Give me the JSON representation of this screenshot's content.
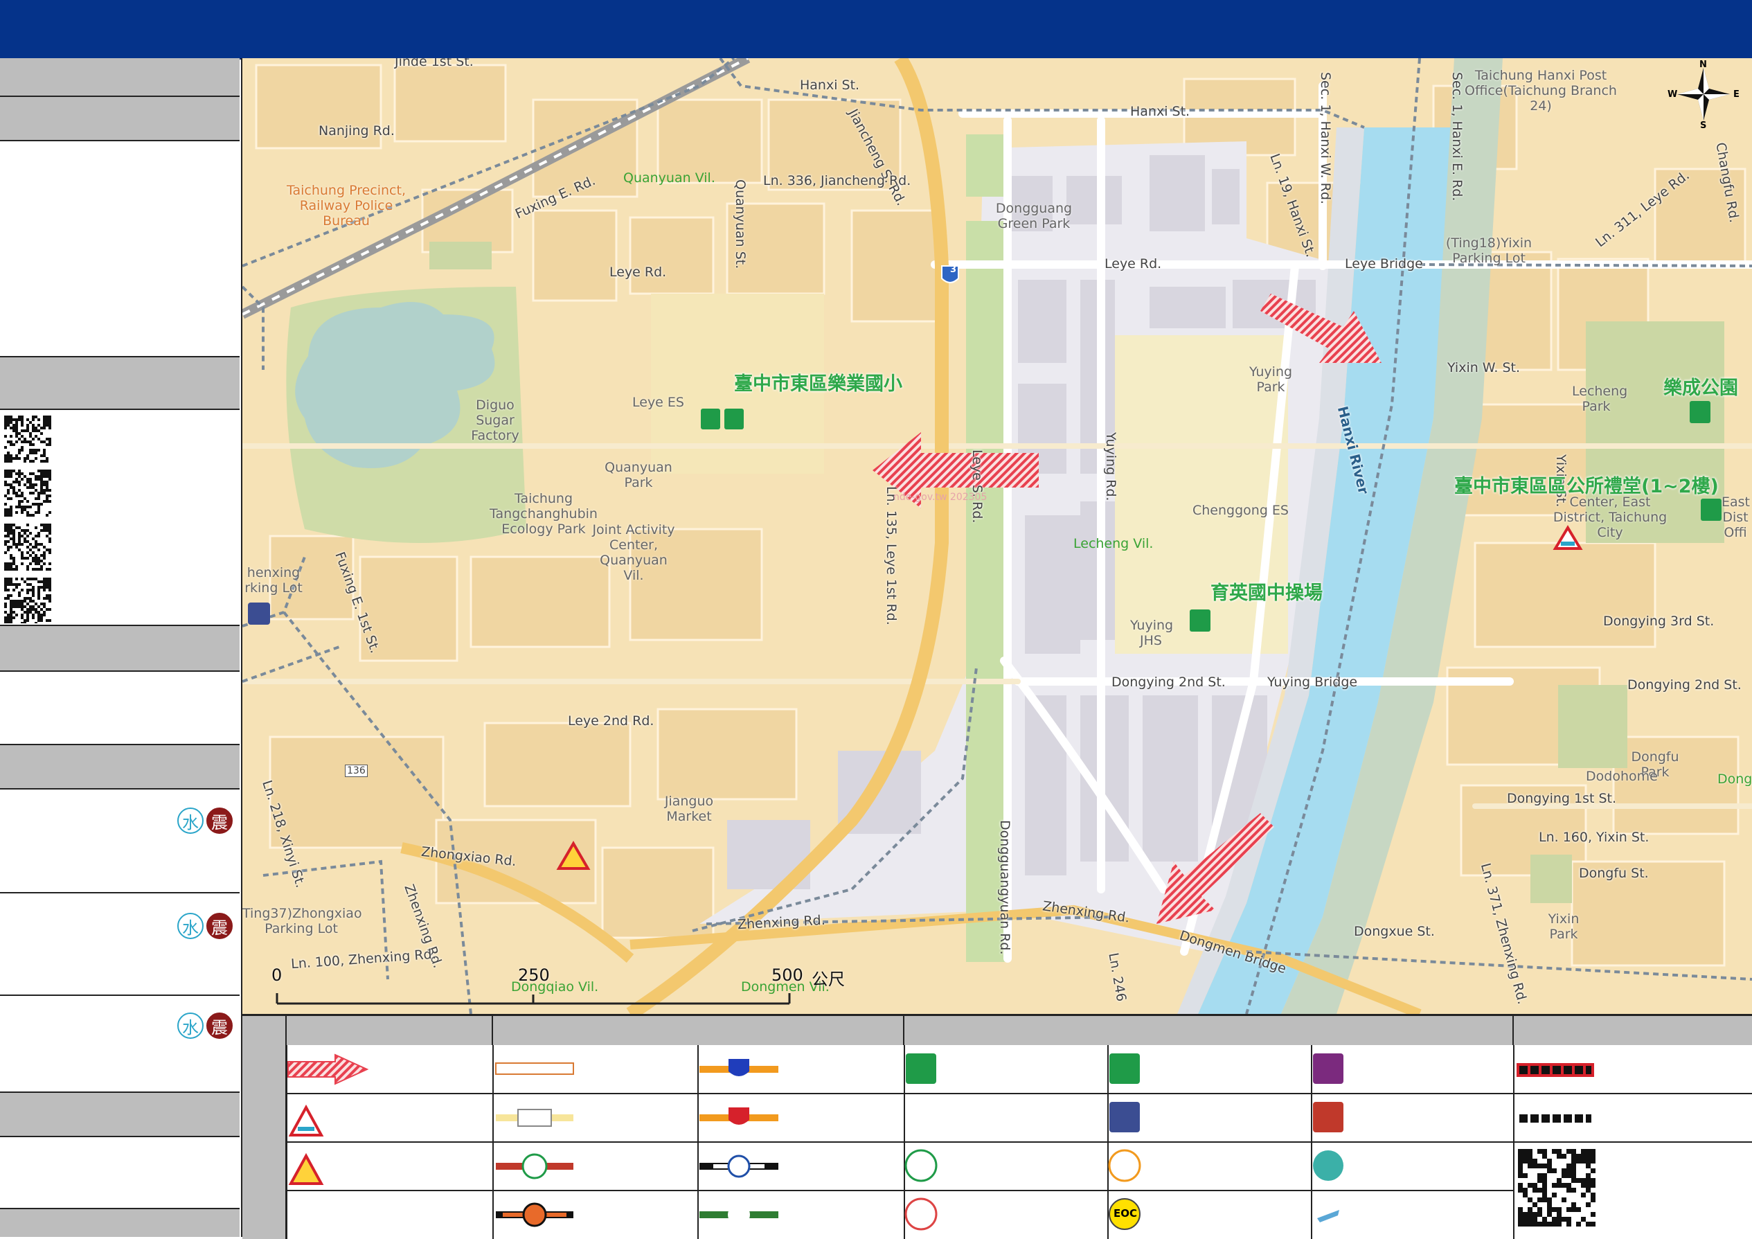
{
  "map": {
    "scale_bar": {
      "tick0": "0",
      "tick1": "250",
      "tick2": "500",
      "unit": "公尺"
    },
    "shelters": [
      {
        "name": "臺中市東區樂業國小"
      },
      {
        "name": "育英國中操場"
      },
      {
        "name": "樂成公園"
      },
      {
        "name": "臺中市東區區公所禮堂(1~2樓)"
      }
    ],
    "roads": [
      "Jinde 1st St.",
      "Nanjing Rd.",
      "Hanxi St.",
      "Hanxi St.",
      "Jiancheng S. Rd.",
      "Fuxing E. Rd.",
      "Ln. 336, Jiancheng Rd.",
      "Quanyuan St.",
      "Leye Rd.",
      "Leye Rd.",
      "Leye Bridge",
      "Ln. 19, Hanxi St.",
      "Sec. 1, Hanxi W. Rd.",
      "Sec. 1, Hanxi E. Rd.",
      "Yuying Rd.",
      "Ln. 135, Leye 1st Rd.",
      "Leye S. Rd.",
      "Fuxing E. 1st St.",
      "Leye 2nd Rd.",
      "Dongying 2nd St.",
      "Yuying Bridge",
      "Dongying 3rd St.",
      "Dongying 2nd St.",
      "Dongying 1st St.",
      "Ln. 160, Yixin St.",
      "Dongfu St.",
      "Dongxue St.",
      "Ln. 371, Zhenxing Rd.",
      "Zhenxing Rd.",
      "Zhenxing Rd.",
      "Dongmen Bridge",
      "Dongguangyuan Rd.",
      "Zhongxiao Rd.",
      "Zhenxing Rd.",
      "Ln. 100, Zhenxing Rd.",
      "Ln. 218, Xinyi St.",
      "Ln. 246",
      "Yixin W. St.",
      "Ln. 311, Leye Rd.",
      "Changfu Rd.",
      "Yixin St.",
      "Hanxi River"
    ],
    "pois": [
      "Taichung Precinct, Railway Police Bureau",
      "Diguo Sugar Factory",
      "Leye ES",
      "Quanyuan Park",
      "Taichung Tangchanghubin Ecology Park",
      "Joint Activity Center, Quanyuan Vil.",
      "Dongguang Green Park",
      "Yuying Park",
      "Chenggong ES",
      "Yuying JHS",
      "Jianguo Market",
      "Taichung Hanxi Post Office(Taichung Branch 24)",
      "(Ting18)Yixin Parking Lot",
      "Lecheng Park",
      "Center, East District, Taichung City",
      "East Dist Offi",
      "Dongfu Park",
      "Dodohome",
      "Yixin Park",
      "Ting37)Zhongxiao Parking Lot",
      "henxing rking Lot",
      "Dong"
    ],
    "villages": [
      "Quanyuan Vil.",
      "Lecheng Vil.",
      "Dongqiao Vil.",
      "Dongmen Vil."
    ],
    "compass": {
      "n": "N",
      "s": "S",
      "e": "E",
      "w": "W"
    },
    "route_number": "3",
    "route_number_2": "136",
    "watermark": "nde-gov.tw 202305"
  },
  "legend": {
    "eoc_label": "EOC"
  },
  "sidebar": {
    "hazard_badges": [
      {
        "water": "水",
        "quake": "震"
      },
      {
        "water": "水",
        "quake": "震"
      },
      {
        "water": "水",
        "quake": "震"
      }
    ]
  },
  "colors": {
    "header": "#05338a",
    "map_base": "#f6e2b6",
    "river": "#a6dcf0",
    "shelter_green": "#2fa84a",
    "evac_arrow": "#e8414f"
  }
}
